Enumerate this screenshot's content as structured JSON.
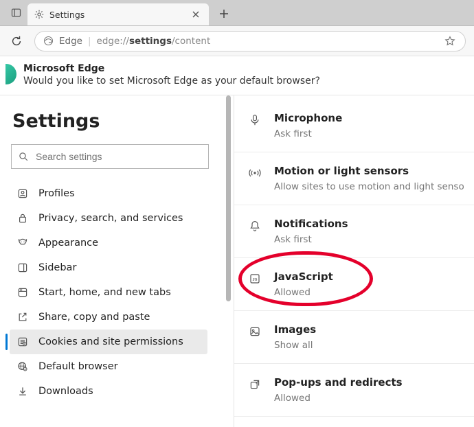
{
  "tab": {
    "title": "Settings"
  },
  "addressbar": {
    "prefix": "Edge",
    "url_prefix": "edge://",
    "url_bold": "settings",
    "url_suffix": "/content"
  },
  "banner": {
    "title": "Microsoft Edge",
    "message": "Would you like to set Microsoft Edge as your default browser?"
  },
  "sidebar": {
    "title": "Settings",
    "search_placeholder": "Search settings",
    "items": [
      {
        "label": "Profiles",
        "active": false
      },
      {
        "label": "Privacy, search, and services",
        "active": false
      },
      {
        "label": "Appearance",
        "active": false
      },
      {
        "label": "Sidebar",
        "active": false
      },
      {
        "label": "Start, home, and new tabs",
        "active": false
      },
      {
        "label": "Share, copy and paste",
        "active": false
      },
      {
        "label": "Cookies and site permissions",
        "active": true
      },
      {
        "label": "Default browser",
        "active": false
      },
      {
        "label": "Downloads",
        "active": false
      }
    ]
  },
  "permissions": [
    {
      "title": "Microphone",
      "sub": "Ask first",
      "icon": "microphone-icon",
      "highlight": false
    },
    {
      "title": "Motion or light sensors",
      "sub": "Allow sites to use motion and light senso",
      "icon": "sensor-icon",
      "highlight": false
    },
    {
      "title": "Notifications",
      "sub": "Ask first",
      "icon": "bell-icon",
      "highlight": false
    },
    {
      "title": "JavaScript",
      "sub": "Allowed",
      "icon": "javascript-icon",
      "highlight": true
    },
    {
      "title": "Images",
      "sub": "Show all",
      "icon": "image-icon",
      "highlight": false
    },
    {
      "title": "Pop-ups and redirects",
      "sub": "Allowed",
      "icon": "popup-icon",
      "highlight": false
    }
  ]
}
